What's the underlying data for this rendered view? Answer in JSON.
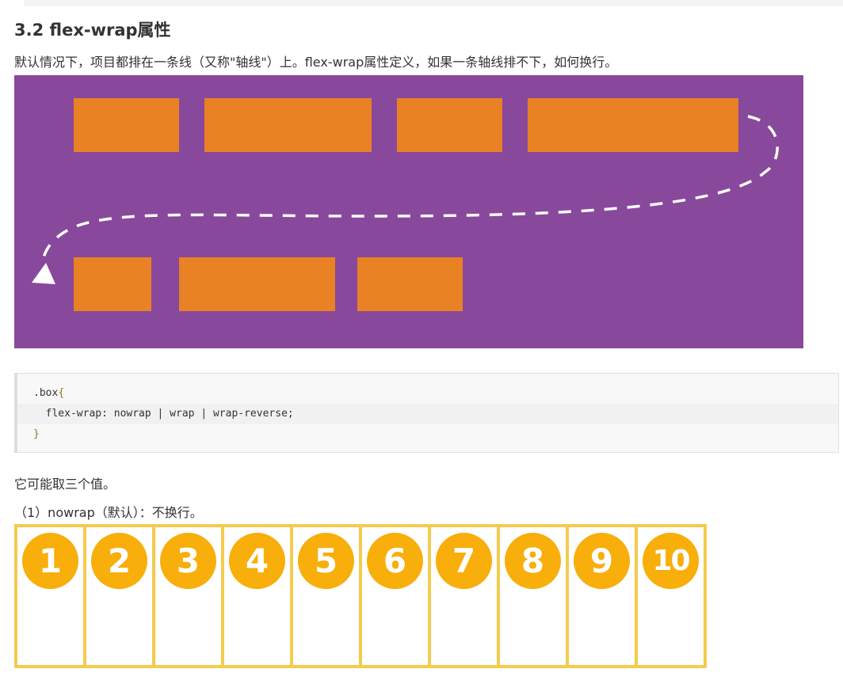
{
  "heading": "3.2 flex-wrap属性",
  "intro": "默认情况下，项目都排在一条线（又称\"轴线\"）上。flex-wrap属性定义，如果一条轴线排不下，如何换行。",
  "code": {
    "line1": ".box",
    "line1_brace": "{",
    "line2": "  flex-wrap: nowrap | wrap | wrap-reverse;",
    "line3": "}"
  },
  "values_intro": "它可能取三个值。",
  "nowrap_caption": "（1）nowrap（默认）：不换行。",
  "demo_items": [
    "1",
    "2",
    "3",
    "4",
    "5",
    "6",
    "7",
    "8",
    "9",
    "10"
  ],
  "colors": {
    "illustration_bg": "#88499c",
    "illustration_box": "#e98125",
    "demo_border": "#f5cb4d",
    "demo_circle": "#f8ae0b"
  }
}
